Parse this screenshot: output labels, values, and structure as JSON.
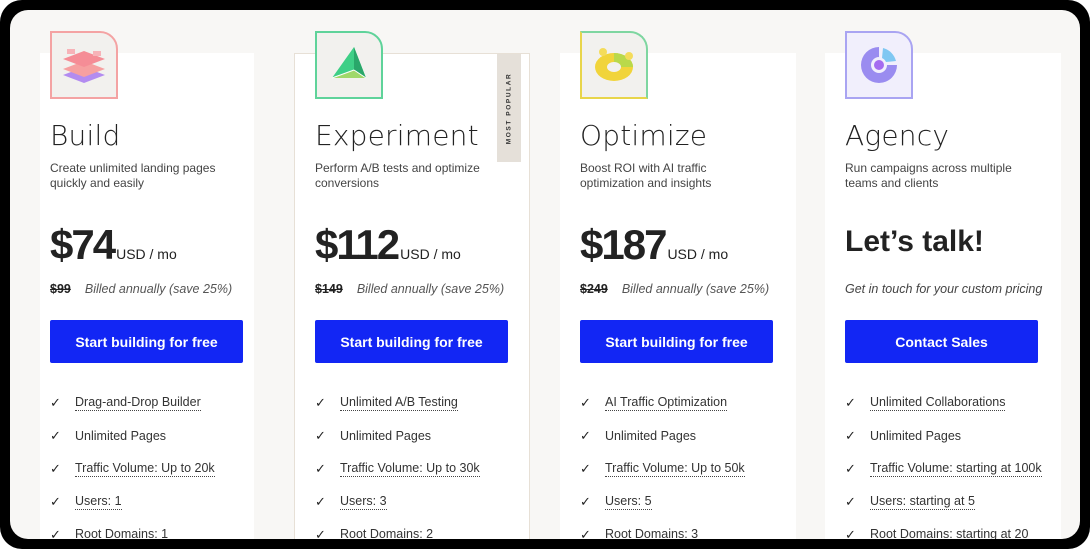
{
  "colors": {
    "cta": "#1226f4",
    "badge_bg": "#e5e0d9",
    "page_bg": "#f8f7f5"
  },
  "plans": [
    {
      "icon": "layers-icon",
      "icon_border": "#f4a3a3",
      "title": "Build",
      "description": "Create unlimited landing pages quickly and easily",
      "price": "$74",
      "price_unit": "USD / mo",
      "old_price": "$99",
      "billing": "Billed annually (save 25%)",
      "cta": "Start building for free",
      "features": [
        "Drag-and-Drop Builder",
        "Unlimited Pages",
        "Traffic Volume: Up to 20k",
        "Users: 1",
        "Root Domains: 1"
      ]
    },
    {
      "icon": "pyramid-icon",
      "icon_border": "#5fd39a",
      "title": "Experiment",
      "badge": "MOST POPULAR",
      "description": "Perform A/B tests and optimize conversions",
      "price": "$112",
      "price_unit": "USD / mo",
      "old_price": "$149",
      "billing": "Billed annually (save 25%)",
      "cta": "Start building for free",
      "features": [
        "Unlimited A/B Testing",
        "Unlimited Pages",
        "Traffic Volume: Up to 30k",
        "Users: 3",
        "Root Domains: 2"
      ]
    },
    {
      "icon": "donut-icon",
      "icon_border": "#e8d54a",
      "title": "Optimize",
      "description": "Boost ROI with AI traffic optimization and insights",
      "price": "$187",
      "price_unit": "USD / mo",
      "old_price": "$249",
      "billing": "Billed annually (save 25%)",
      "cta": "Start building for free",
      "features": [
        "AI Traffic Optimization",
        "Unlimited Pages",
        "Traffic Volume: Up to 50k",
        "Users: 5",
        "Root Domains: 3"
      ]
    },
    {
      "icon": "ring-icon",
      "icon_border": "#a9a4f2",
      "title": "Agency",
      "description": "Run campaigns across multiple teams and clients",
      "headline": "Let’s talk!",
      "custom_note": "Get in touch for your custom pricing",
      "cta": "Contact Sales",
      "features": [
        "Unlimited Collaborations",
        "Unlimited Pages",
        "Traffic Volume: starting at 100k",
        "Users: starting at 5",
        "Root Domains: starting at 20"
      ]
    }
  ]
}
